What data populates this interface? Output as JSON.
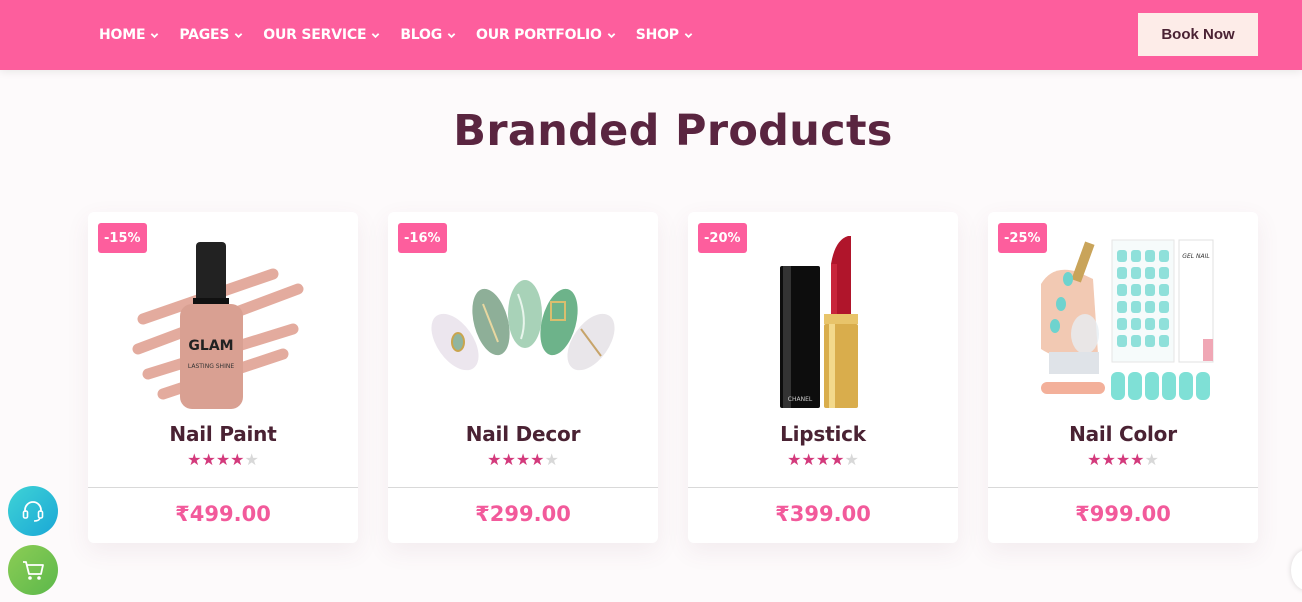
{
  "nav": {
    "items": [
      {
        "label": "HOME",
        "icon": "chevron-down-icon"
      },
      {
        "label": "PAGES",
        "icon": "chevron-down-icon"
      },
      {
        "label": "OUR SERVICE",
        "icon": "chevron-down-icon"
      },
      {
        "label": "BLOG",
        "icon": "chevron-down-icon"
      },
      {
        "label": "OUR PORTFOLIO",
        "icon": "chevron-down-icon"
      },
      {
        "label": "SHOP",
        "icon": "chevron-down-icon"
      }
    ],
    "book_label": "Book Now"
  },
  "section": {
    "title": "Branded Products"
  },
  "products": [
    {
      "badge": "-15%",
      "name": "Nail Paint",
      "rating": 4,
      "max_rating": 5,
      "price": "₹499.00",
      "image": "nail-polish-bottle",
      "brand_text": "GLAM",
      "brand_sub": "LASTING SHINE"
    },
    {
      "badge": "-16%",
      "name": "Nail Decor",
      "rating": 4,
      "max_rating": 5,
      "price": "₹299.00",
      "image": "decorated-nail-tips"
    },
    {
      "badge": "-20%",
      "name": "Lipstick",
      "rating": 4,
      "max_rating": 5,
      "price": "₹399.00",
      "image": "red-lipstick",
      "brand_text": "CHANEL"
    },
    {
      "badge": "-25%",
      "name": "Nail Color",
      "rating": 4,
      "max_rating": 5,
      "price": "₹999.00",
      "image": "gel-nail-kit",
      "brand_text": "GEL NAIL"
    }
  ],
  "floating": {
    "support_icon": "headset-icon",
    "cart_icon": "cart-icon"
  },
  "colors": {
    "brand_pink": "#fd5e9d",
    "title": "#5a2540",
    "price": "#f25a9b",
    "star_on": "#d33a7c",
    "star_off": "#d8d8d8"
  }
}
